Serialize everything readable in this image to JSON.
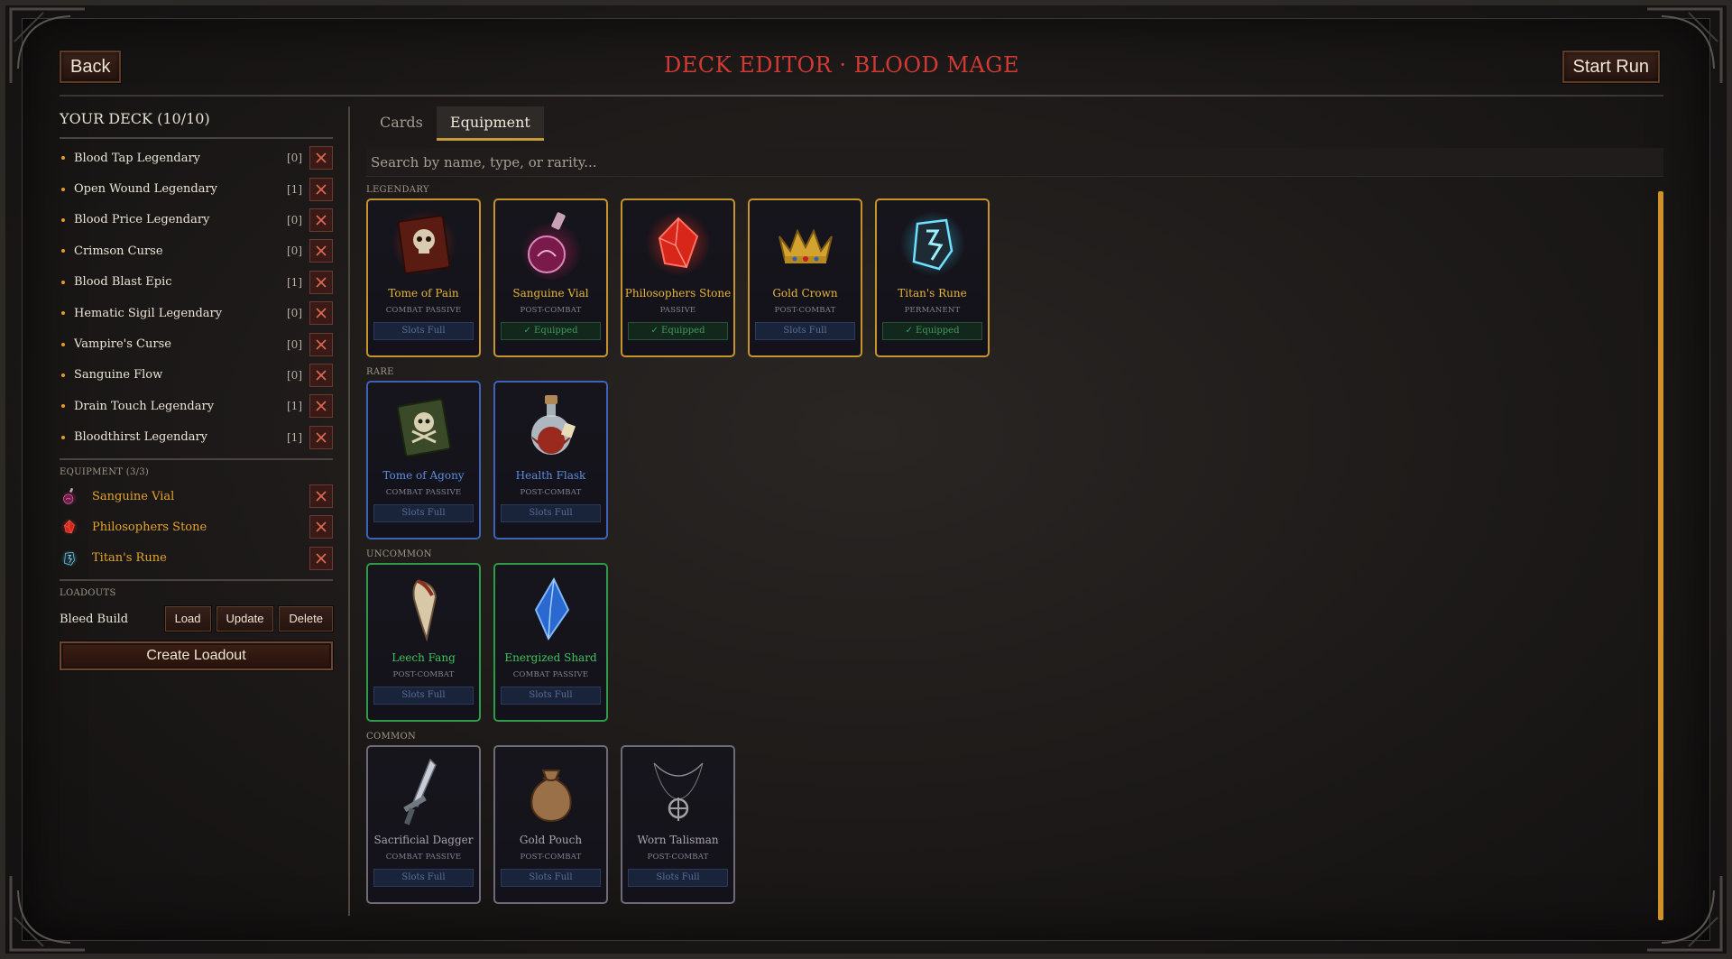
{
  "header": {
    "back_label": "Back",
    "title": "DECK EDITOR · BLOOD MAGE",
    "start_label": "Start Run"
  },
  "deck": {
    "title": "YOUR DECK (10/10)",
    "items": [
      {
        "name": "Blood Tap Legendary",
        "count": "[0]"
      },
      {
        "name": "Open Wound Legendary",
        "count": "[1]"
      },
      {
        "name": "Blood Price Legendary",
        "count": "[0]"
      },
      {
        "name": "Crimson Curse",
        "count": "[0]"
      },
      {
        "name": "Blood Blast Epic",
        "count": "[1]"
      },
      {
        "name": "Hematic Sigil Legendary",
        "count": "[0]"
      },
      {
        "name": "Vampire's Curse",
        "count": "[0]"
      },
      {
        "name": "Sanguine Flow",
        "count": "[0]"
      },
      {
        "name": "Drain Touch Legendary",
        "count": "[1]"
      },
      {
        "name": "Bloodthirst Legendary",
        "count": "[1]"
      }
    ]
  },
  "equipment": {
    "title": "EQUIPMENT (3/3)",
    "items": [
      {
        "name": "Sanguine Vial",
        "icon": "potion-icon"
      },
      {
        "name": "Philosophers Stone",
        "icon": "red-crystal-icon"
      },
      {
        "name": "Titan's Rune",
        "icon": "rune-icon"
      }
    ]
  },
  "loadouts": {
    "title": "LOADOUTS",
    "name": "Bleed Build",
    "load_label": "Load",
    "update_label": "Update",
    "delete_label": "Delete",
    "create_label": "Create Loadout"
  },
  "tabs": [
    {
      "label": "Cards",
      "active": false
    },
    {
      "label": "Equipment",
      "active": true
    }
  ],
  "search": {
    "placeholder": "Search by name, type, or rarity...",
    "value": ""
  },
  "groups": [
    {
      "rarity": "LEGENDARY",
      "items": [
        {
          "name": "Tome of Pain",
          "type": "COMBAT PASSIVE",
          "status": "Slots Full",
          "equipped": false,
          "icon": "skull-tome-icon"
        },
        {
          "name": "Sanguine Vial",
          "type": "POST-COMBAT",
          "status": "✓ Equipped",
          "equipped": true,
          "icon": "potion-icon"
        },
        {
          "name": "Philosophers Stone",
          "type": "PASSIVE",
          "status": "✓ Equipped",
          "equipped": true,
          "icon": "red-crystal-icon"
        },
        {
          "name": "Gold Crown",
          "type": "POST-COMBAT",
          "status": "Slots Full",
          "equipped": false,
          "icon": "crown-icon"
        },
        {
          "name": "Titan's Rune",
          "type": "PERMANENT",
          "status": "✓ Equipped",
          "equipped": true,
          "icon": "rune-icon"
        }
      ]
    },
    {
      "rarity": "RARE",
      "items": [
        {
          "name": "Tome of Agony",
          "type": "COMBAT PASSIVE",
          "status": "Slots Full",
          "equipped": false,
          "icon": "green-tome-icon"
        },
        {
          "name": "Health Flask",
          "type": "POST-COMBAT",
          "status": "Slots Full",
          "equipped": false,
          "icon": "flask-icon"
        }
      ]
    },
    {
      "rarity": "UNCOMMON",
      "items": [
        {
          "name": "Leech Fang",
          "type": "POST-COMBAT",
          "status": "Slots Full",
          "equipped": false,
          "icon": "fang-icon"
        },
        {
          "name": "Energized Shard",
          "type": "COMBAT PASSIVE",
          "status": "Slots Full",
          "equipped": false,
          "icon": "blue-shard-icon"
        }
      ]
    },
    {
      "rarity": "COMMON",
      "items": [
        {
          "name": "Sacrificial Dagger",
          "type": "COMBAT PASSIVE",
          "status": "Slots Full",
          "equipped": false,
          "icon": "dagger-icon"
        },
        {
          "name": "Gold Pouch",
          "type": "POST-COMBAT",
          "status": "Slots Full",
          "equipped": false,
          "icon": "pouch-icon"
        },
        {
          "name": "Worn Talisman",
          "type": "POST-COMBAT",
          "status": "Slots Full",
          "equipped": false,
          "icon": "talisman-icon"
        }
      ]
    }
  ],
  "colors": {
    "title_red": "#d23a33",
    "legendary": "#c6932e",
    "rare": "#3d63b8",
    "uncommon": "#2f9a4a",
    "common": "#6e6a76",
    "accent_orange": "#d0902a"
  }
}
